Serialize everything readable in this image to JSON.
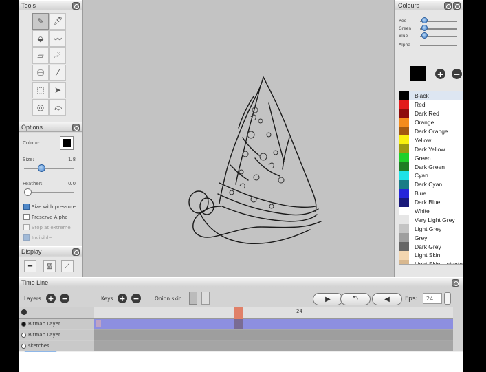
{
  "panels": {
    "tools": {
      "title": "Tools"
    },
    "options": {
      "title": "Options"
    },
    "display": {
      "title": "Display"
    },
    "colours": {
      "title": "Colours"
    },
    "timeline": {
      "title": "Time Line"
    }
  },
  "options": {
    "colour_label": "Colour:",
    "size_label": "Size:",
    "size_value": "1.8",
    "feather_label": "Feather:",
    "feather_value": "0.0",
    "checkboxes": [
      {
        "label": "Size with pressure",
        "checked": true,
        "enabled": true
      },
      {
        "label": "Preserve Alpha",
        "checked": false,
        "enabled": true
      },
      {
        "label": "Stop at extreme",
        "checked": false,
        "enabled": false
      },
      {
        "label": "Invisible",
        "checked": true,
        "enabled": false
      }
    ]
  },
  "colours": {
    "rgba_labels": [
      "Red",
      "Green",
      "Blue",
      "Alpha"
    ],
    "current_colour": "#000000",
    "list": [
      {
        "name": "Black",
        "color": "#000000"
      },
      {
        "name": "Red",
        "color": "#e21b1b"
      },
      {
        "name": "Dark Red",
        "color": "#8e0c0c"
      },
      {
        "name": "Orange",
        "color": "#f48c1c"
      },
      {
        "name": "Dark Orange",
        "color": "#a35a10"
      },
      {
        "name": "Yellow",
        "color": "#f9f10f"
      },
      {
        "name": "Dark Yellow",
        "color": "#9c9a12"
      },
      {
        "name": "Green",
        "color": "#1fd02a"
      },
      {
        "name": "Dark Green",
        "color": "#1e7d23"
      },
      {
        "name": "Cyan",
        "color": "#1ee3e6"
      },
      {
        "name": "Dark Cyan",
        "color": "#1a7c86"
      },
      {
        "name": "Blue",
        "color": "#2626d9"
      },
      {
        "name": "Dark Blue",
        "color": "#19197a"
      },
      {
        "name": "White",
        "color": "#ffffff"
      },
      {
        "name": "Very Light Grey",
        "color": "#e6e6e6"
      },
      {
        "name": "Light Grey",
        "color": "#c4c4c4"
      },
      {
        "name": "Grey",
        "color": "#9e9e9e"
      },
      {
        "name": "Dark Grey",
        "color": "#666666"
      },
      {
        "name": "Light Skin",
        "color": "#f3d6b0"
      },
      {
        "name": "Light Skin – shade",
        "color": "#d8b88f"
      }
    ]
  },
  "timeline": {
    "layers_label": "Layers:",
    "keys_label": "Keys:",
    "onion_label": "Onion skin:",
    "fps_label": "Fps:",
    "fps_value": "24",
    "ruler_mark": "24",
    "layers": [
      {
        "name": "Bitmap Layer",
        "visible": true
      },
      {
        "name": "Bitmap Layer",
        "visible": false
      },
      {
        "name": "sketches",
        "visible": false
      }
    ]
  }
}
